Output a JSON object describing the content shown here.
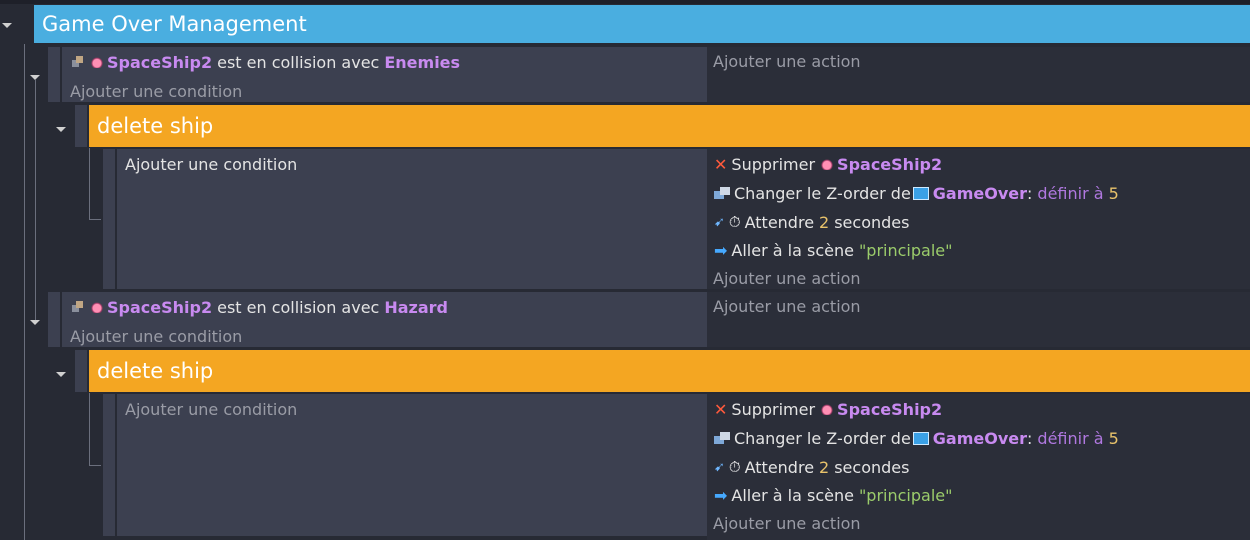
{
  "group": {
    "title": "Game Over Management"
  },
  "add_condition_label": "Ajouter une condition",
  "add_action_label": "Ajouter une action",
  "events": [
    {
      "condition": {
        "object": "SpaceShip2",
        "text": "est en collision avec",
        "target": "Enemies"
      },
      "subevent": {
        "title": "delete ship",
        "actions": {
          "delete": {
            "verb": "Supprimer",
            "object": "SpaceShip2"
          },
          "zorder": {
            "text": "Changer le Z-order de",
            "object": "GameOver",
            "colon": ":",
            "param": "définir à",
            "value": "5"
          },
          "wait": {
            "text": "Attendre",
            "value": "2",
            "unit": "secondes"
          },
          "scene": {
            "text": "Aller à la scène",
            "value": "\"principale\""
          }
        }
      }
    },
    {
      "condition": {
        "object": "SpaceShip2",
        "text": "est en collision avec",
        "target": "Hazard"
      },
      "subevent": {
        "title": "delete ship",
        "actions": {
          "delete": {
            "verb": "Supprimer",
            "object": "SpaceShip2"
          },
          "zorder": {
            "text": "Changer le Z-order de",
            "object": "GameOver",
            "colon": ":",
            "param": "définir à",
            "value": "5"
          },
          "wait": {
            "text": "Attendre",
            "value": "2",
            "unit": "secondes"
          },
          "scene": {
            "text": "Aller à la scène",
            "value": "\"principale\""
          }
        }
      }
    }
  ],
  "icons": [
    "collision-icon",
    "spaceship-icon",
    "delete-icon",
    "zorder-icon",
    "gameover-object-icon",
    "wait-icon",
    "timer-icon",
    "scene-icon",
    "collapse-arrow-icon"
  ],
  "colors": {
    "group_header": "#4aaee0",
    "subevent_header": "#f4a622",
    "object_name": "#c88af0",
    "number": "#e9c36b",
    "string": "#9bcc6b"
  }
}
